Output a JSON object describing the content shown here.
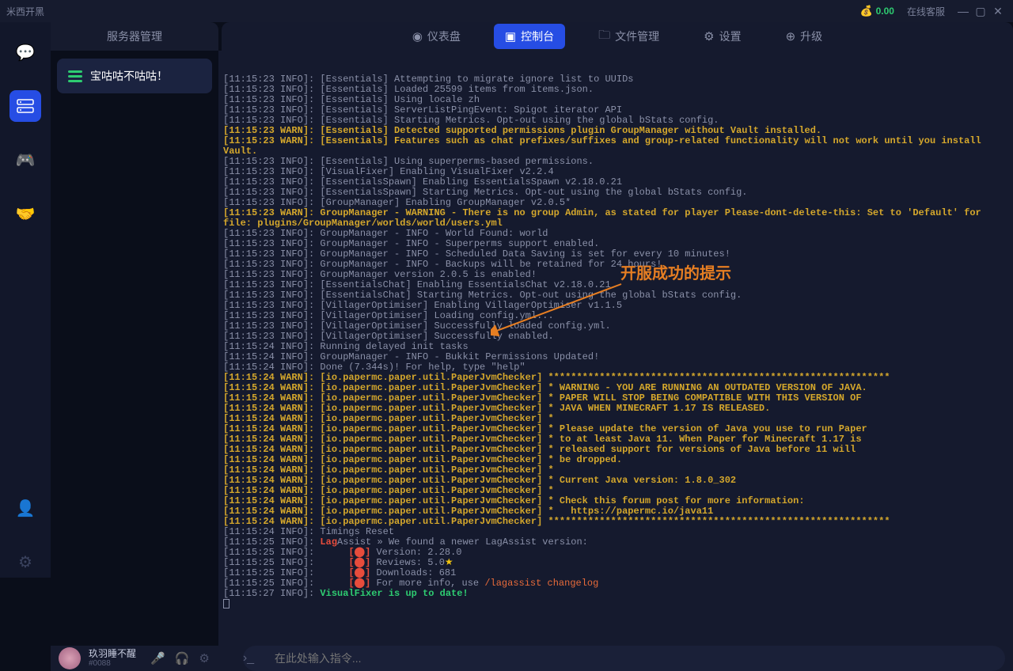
{
  "titlebar": {
    "title": "米西开黑",
    "balance": "0.00",
    "support": "在线客服"
  },
  "left_header": "服务器管理",
  "tabs": {
    "dashboard": "仪表盘",
    "console": "控制台",
    "files": "文件管理",
    "settings": "设置",
    "upgrade": "升级"
  },
  "server_card": {
    "name": "宝咕咕不咕咕！"
  },
  "annotation": "开服成功的提示",
  "user": {
    "name": "玖羽睡不醒",
    "id": "#0088"
  },
  "cmd_placeholder": "在此处输入指令...",
  "console_lines": [
    {
      "cls": "info",
      "text": "[11:15:23 INFO]: [Essentials] Attempting to migrate ignore list to UUIDs"
    },
    {
      "cls": "info",
      "text": "[11:15:23 INFO]: [Essentials] Loaded 25599 items from items.json."
    },
    {
      "cls": "info",
      "text": "[11:15:23 INFO]: [Essentials] Using locale zh"
    },
    {
      "cls": "info",
      "text": "[11:15:23 INFO]: [Essentials] ServerListPingEvent: Spigot iterator API"
    },
    {
      "cls": "info",
      "text": "[11:15:23 INFO]: [Essentials] Starting Metrics. Opt-out using the global bStats config."
    },
    {
      "cls": "warn",
      "text": "[11:15:23 WARN]: [Essentials] Detected supported permissions plugin GroupManager without Vault installed."
    },
    {
      "cls": "warn",
      "text": "[11:15:23 WARN]: [Essentials] Features such as chat prefixes/suffixes and group-related functionality will not work until you install Vault."
    },
    {
      "cls": "info",
      "text": "[11:15:23 INFO]: [Essentials] Using superperms-based permissions."
    },
    {
      "cls": "info",
      "text": "[11:15:23 INFO]: [VisualFixer] Enabling VisualFixer v2.2.4"
    },
    {
      "cls": "info",
      "text": "[11:15:23 INFO]: [EssentialsSpawn] Enabling EssentialsSpawn v2.18.0.21"
    },
    {
      "cls": "info",
      "text": "[11:15:23 INFO]: [EssentialsSpawn] Starting Metrics. Opt-out using the global bStats config."
    },
    {
      "cls": "info",
      "text": "[11:15:23 INFO]: [GroupManager] Enabling GroupManager v2.0.5*"
    },
    {
      "cls": "warn",
      "text": "[11:15:23 WARN]: GroupManager - WARNING - There is no group Admin, as stated for player Please-dont-delete-this: Set to 'Default' for file: plugins/GroupManager/worlds/world/users.yml"
    },
    {
      "cls": "info",
      "text": "[11:15:23 INFO]: GroupManager - INFO - World Found: world"
    },
    {
      "cls": "info",
      "text": "[11:15:23 INFO]: GroupManager - INFO - Superperms support enabled."
    },
    {
      "cls": "info",
      "text": "[11:15:23 INFO]: GroupManager - INFO - Scheduled Data Saving is set for every 10 minutes!"
    },
    {
      "cls": "info",
      "text": "[11:15:23 INFO]: GroupManager - INFO - Backups will be retained for 24 hours!"
    },
    {
      "cls": "info",
      "text": "[11:15:23 INFO]: GroupManager version 2.0.5 is enabled!"
    },
    {
      "cls": "info",
      "text": "[11:15:23 INFO]: [EssentialsChat] Enabling EssentialsChat v2.18.0.21"
    },
    {
      "cls": "info",
      "text": "[11:15:23 INFO]: [EssentialsChat] Starting Metrics. Opt-out using the global bStats config."
    },
    {
      "cls": "info",
      "text": "[11:15:23 INFO]: [VillagerOptimiser] Enabling VillagerOptimiser v1.1.5"
    },
    {
      "cls": "info",
      "text": "[11:15:23 INFO]: [VillagerOptimiser] Loading config.yml..."
    },
    {
      "cls": "info",
      "text": "[11:15:23 INFO]: [VillagerOptimiser] Successfully loaded config.yml."
    },
    {
      "cls": "info",
      "text": "[11:15:23 INFO]: [VillagerOptimiser] Successfully enabled."
    },
    {
      "cls": "info",
      "text": "[11:15:24 INFO]: Running delayed init tasks"
    },
    {
      "cls": "info",
      "text": "[11:15:24 INFO]: GroupManager - INFO - Bukkit Permissions Updated!"
    },
    {
      "cls": "info",
      "text": "[11:15:24 INFO]: Done (7.344s)! For help, type \"help\""
    },
    {
      "cls": "warn",
      "text": "[11:15:24 WARN]: [io.papermc.paper.util.PaperJvmChecker] ************************************************************"
    },
    {
      "cls": "warn",
      "text": "[11:15:24 WARN]: [io.papermc.paper.util.PaperJvmChecker] * WARNING - YOU ARE RUNNING AN OUTDATED VERSION OF JAVA."
    },
    {
      "cls": "warn",
      "text": "[11:15:24 WARN]: [io.papermc.paper.util.PaperJvmChecker] * PAPER WILL STOP BEING COMPATIBLE WITH THIS VERSION OF"
    },
    {
      "cls": "warn",
      "text": "[11:15:24 WARN]: [io.papermc.paper.util.PaperJvmChecker] * JAVA WHEN MINECRAFT 1.17 IS RELEASED."
    },
    {
      "cls": "warn",
      "text": "[11:15:24 WARN]: [io.papermc.paper.util.PaperJvmChecker] *"
    },
    {
      "cls": "warn",
      "text": "[11:15:24 WARN]: [io.papermc.paper.util.PaperJvmChecker] * Please update the version of Java you use to run Paper"
    },
    {
      "cls": "warn",
      "text": "[11:15:24 WARN]: [io.papermc.paper.util.PaperJvmChecker] * to at least Java 11. When Paper for Minecraft 1.17 is"
    },
    {
      "cls": "warn",
      "text": "[11:15:24 WARN]: [io.papermc.paper.util.PaperJvmChecker] * released support for versions of Java before 11 will"
    },
    {
      "cls": "warn",
      "text": "[11:15:24 WARN]: [io.papermc.paper.util.PaperJvmChecker] * be dropped."
    },
    {
      "cls": "warn",
      "text": "[11:15:24 WARN]: [io.papermc.paper.util.PaperJvmChecker] *"
    },
    {
      "cls": "warn",
      "text": "[11:15:24 WARN]: [io.papermc.paper.util.PaperJvmChecker] * Current Java version: 1.8.0_302"
    },
    {
      "cls": "warn",
      "text": "[11:15:24 WARN]: [io.papermc.paper.util.PaperJvmChecker] *"
    },
    {
      "cls": "warn",
      "text": "[11:15:24 WARN]: [io.papermc.paper.util.PaperJvmChecker] * Check this forum post for more information:"
    },
    {
      "cls": "warn",
      "text": "[11:15:24 WARN]: [io.papermc.paper.util.PaperJvmChecker] *   https://papermc.io/java11"
    },
    {
      "cls": "warn",
      "text": "[11:15:24 WARN]: [io.papermc.paper.util.PaperJvmChecker] ************************************************************"
    },
    {
      "cls": "info",
      "text": "[11:15:24 INFO]: Timings Reset"
    },
    {
      "cls": "lag1",
      "prefix": "[11:15:25 INFO]: ",
      "spans": [
        {
          "cls": "lag-red",
          "text": "Lag"
        },
        {
          "cls": "info",
          "text": "Assist » We found a newer LagAssist version:"
        }
      ]
    },
    {
      "cls": "lag2",
      "prefix": "[11:15:25 INFO]:      ",
      "spans": [
        {
          "cls": "lag-red",
          "text": "[⬤]"
        },
        {
          "cls": "info",
          "text": " Version: 2.28.0"
        }
      ]
    },
    {
      "cls": "lag3",
      "prefix": "[11:15:25 INFO]:      ",
      "spans": [
        {
          "cls": "lag-red",
          "text": "[⬤]"
        },
        {
          "cls": "info",
          "text": " Reviews: 5.0"
        },
        {
          "cls": "star",
          "text": "★"
        }
      ]
    },
    {
      "cls": "lag4",
      "prefix": "[11:15:25 INFO]:      ",
      "spans": [
        {
          "cls": "lag-red",
          "text": "[⬤]"
        },
        {
          "cls": "info",
          "text": " Downloads: 681"
        }
      ]
    },
    {
      "cls": "lag5",
      "prefix": "[11:15:25 INFO]:      ",
      "spans": [
        {
          "cls": "lag-red",
          "text": "[⬤]"
        },
        {
          "cls": "info",
          "text": " For more info, use "
        },
        {
          "cls": "lag-cmd",
          "text": "/lagassist changelog"
        }
      ]
    },
    {
      "cls": "vf",
      "prefix": "[11:15:27 INFO]: ",
      "spans": [
        {
          "cls": "visualfixer",
          "text": "VisualFixer is up to date!"
        }
      ]
    }
  ]
}
